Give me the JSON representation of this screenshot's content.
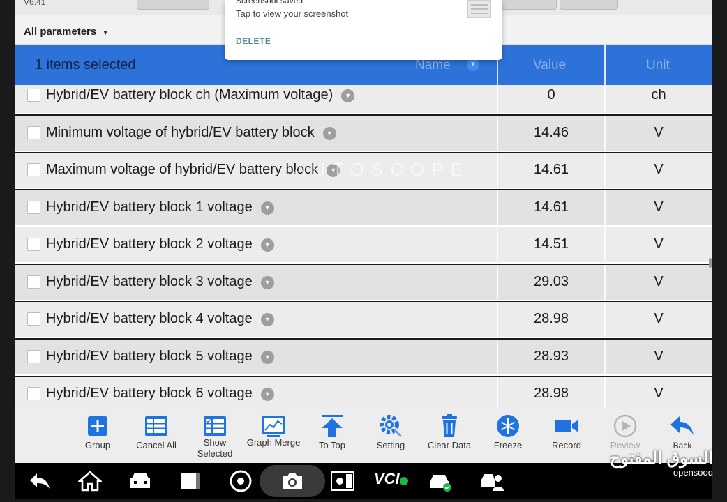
{
  "app": {
    "version": "V6.41",
    "watermark": "AUTOSCOPE"
  },
  "filter": {
    "label": "All parameters"
  },
  "toast": {
    "title": "Screenshot saved",
    "subtitle": "Tap to view your screenshot",
    "action": "DELETE"
  },
  "table": {
    "selected_count": "1 items selected",
    "columns": {
      "name": "Name",
      "value": "Value",
      "unit": "Unit"
    },
    "rows": [
      {
        "name": "Hybrid/EV battery block ch (Maximum voltage)",
        "value": "0",
        "unit": "ch"
      },
      {
        "name": "Minimum voltage of hybrid/EV battery block",
        "value": "14.46",
        "unit": "V"
      },
      {
        "name": "Maximum voltage of hybrid/EV battery block",
        "value": "14.61",
        "unit": "V"
      },
      {
        "name": "Hybrid/EV battery block 1 voltage",
        "value": "14.61",
        "unit": "V"
      },
      {
        "name": "Hybrid/EV battery block 2 voltage",
        "value": "14.51",
        "unit": "V"
      },
      {
        "name": "Hybrid/EV battery block 3 voltage",
        "value": "29.03",
        "unit": "V"
      },
      {
        "name": "Hybrid/EV battery block 4 voltage",
        "value": "28.98",
        "unit": "V"
      },
      {
        "name": "Hybrid/EV battery block 5 voltage",
        "value": "28.93",
        "unit": "V"
      },
      {
        "name": "Hybrid/EV battery block 6 voltage",
        "value": "28.98",
        "unit": "V"
      }
    ]
  },
  "toolbar": {
    "items": [
      {
        "label": "Group",
        "icon": "group-icon"
      },
      {
        "label": "Cancel All",
        "icon": "cancel-all-icon"
      },
      {
        "label": "Show Selected",
        "icon": "show-selected-icon"
      },
      {
        "label": "Graph Merge",
        "icon": "graph-merge-icon"
      },
      {
        "label": "To Top",
        "icon": "to-top-icon"
      },
      {
        "label": "Setting",
        "icon": "setting-icon"
      },
      {
        "label": "Clear Data",
        "icon": "clear-data-icon"
      },
      {
        "label": "Freeze",
        "icon": "freeze-icon"
      },
      {
        "label": "Record",
        "icon": "record-icon"
      },
      {
        "label": "Review",
        "icon": "review-icon"
      },
      {
        "label": "Back",
        "icon": "back-icon"
      }
    ]
  },
  "navbar": {
    "vci_label": "VCI",
    "icons": [
      "back-arrow-icon",
      "home-icon",
      "car-repair-icon",
      "window-icon",
      "browser-icon",
      "camera-icon",
      "brightness-icon",
      "vci-icon",
      "car-status-icon",
      "technician-icon"
    ]
  },
  "overlay_logo": {
    "arabic": "السوق المفتوح",
    "latin": "opensooq"
  },
  "colors": {
    "header_blue": "#2c72d8",
    "icon_blue": "#1e73e0",
    "row_light": "#ececec",
    "row_dark": "#e2e2e2"
  }
}
